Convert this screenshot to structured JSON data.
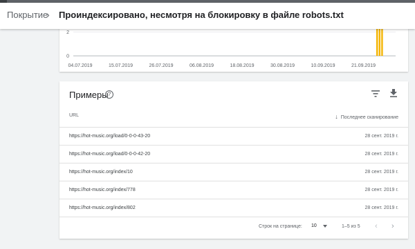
{
  "header": {
    "breadcrumb": "Покрытие",
    "chevron": "›",
    "title": "Проиндексировано, несмотря на блокировку в файле robots.txt"
  },
  "colors": {
    "bar": "#f4b400",
    "header_bg": "#ffffff",
    "page_bg": "#f1f3f4"
  },
  "chart_data": {
    "type": "bar",
    "x_tick_labels": [
      "04.07.2019",
      "15.07.2019",
      "26.07.2019",
      "06.08.2019",
      "18.08.2019",
      "30.08.2019",
      "10.09.2019",
      "21.09.2019"
    ],
    "y_tick_labels": [
      "2",
      "0"
    ],
    "ylim": [
      0,
      2.5
    ],
    "series": [
      {
        "values": [
          0,
          0,
          0,
          0,
          0,
          0,
          0,
          0,
          0,
          5,
          5,
          5
        ]
      }
    ],
    "grid": true
  },
  "examples": {
    "title": "Примеры",
    "help_icon": "help-circle-icon",
    "filter_icon": "filter-icon",
    "download_icon": "download-icon",
    "col_url": "URL",
    "col_crawled": "Последнее сканирование",
    "sort_arrow": "↓",
    "rows": [
      {
        "url": "https://hot-music.org/load/0-0-0-43-20",
        "date": "28 сент. 2019 г."
      },
      {
        "url": "https://hot-music.org/load/0-0-0-42-20",
        "date": "28 сент. 2019 г."
      },
      {
        "url": "https://hot-music.org/index/10",
        "date": "28 сент. 2019 г."
      },
      {
        "url": "https://hot-music.org/index/778",
        "date": "28 сент. 2019 г."
      },
      {
        "url": "https://hot-music.org/index/802",
        "date": "28 сент. 2019 г."
      }
    ],
    "pager": {
      "rows_per_page_label": "Строк на странице:",
      "rows_per_page_value": "10",
      "range": "1–5 из 5",
      "prev": "‹",
      "next": "›"
    }
  }
}
